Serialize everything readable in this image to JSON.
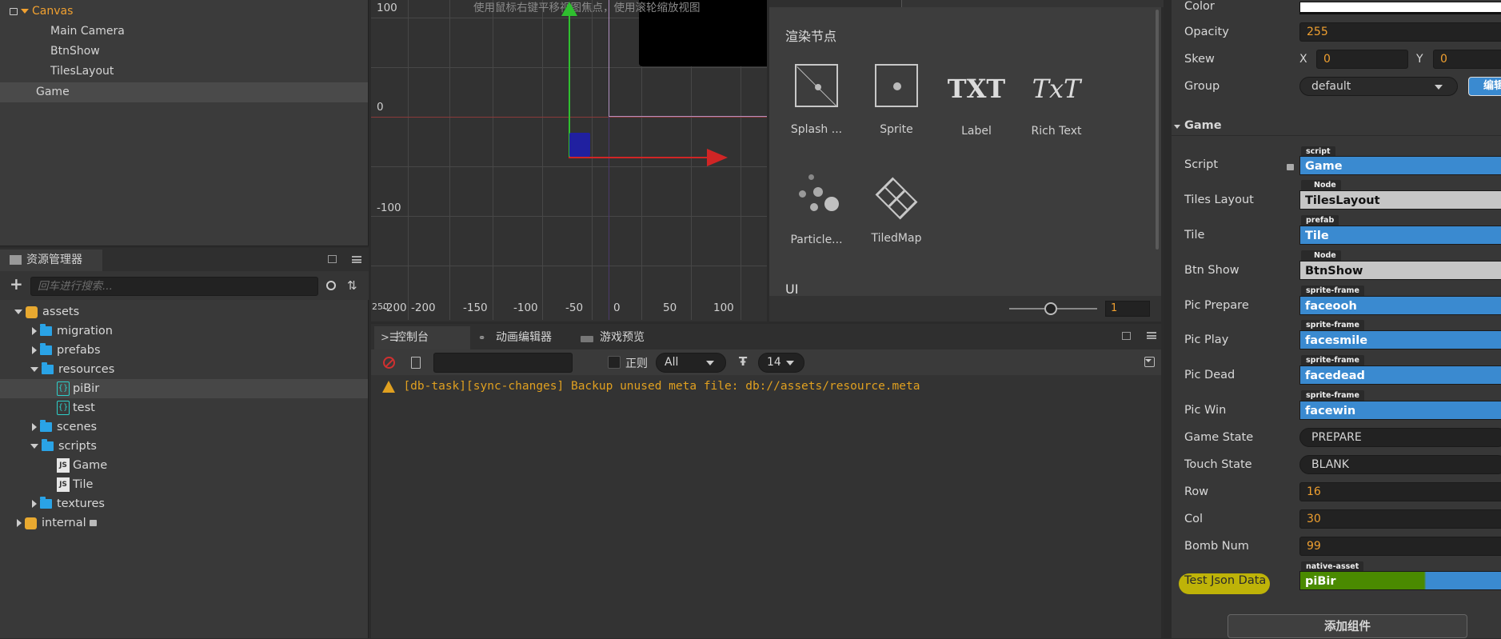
{
  "hierarchy": {
    "items": [
      {
        "label": "Canvas"
      },
      {
        "label": "Main Camera"
      },
      {
        "label": "BtnShow"
      },
      {
        "label": "TilesLayout"
      },
      {
        "label": "Game"
      }
    ]
  },
  "assets": {
    "title": "资源管理器",
    "search_placeholder": "回车进行搜索...",
    "items": [
      {
        "label": "assets"
      },
      {
        "label": "migration"
      },
      {
        "label": "prefabs"
      },
      {
        "label": "resources"
      },
      {
        "label": "piBir"
      },
      {
        "label": "test"
      },
      {
        "label": "scenes"
      },
      {
        "label": "scripts"
      },
      {
        "label": "Game"
      },
      {
        "label": "Tile"
      },
      {
        "label": "textures"
      },
      {
        "label": "internal"
      }
    ],
    "json_icon": "{}",
    "js_icon": "JS"
  },
  "scene": {
    "hint": "使用鼠标右键平移视图焦点，使用滚轮缩放视图",
    "y_ticks": [
      "100",
      "0",
      "-100",
      "-200"
    ],
    "x_ticks": [
      "250",
      "-200",
      "-150",
      "-100",
      "-50",
      "0",
      "50",
      "100"
    ],
    "zoom_value": "1"
  },
  "components": {
    "section_render": "渲染节点",
    "items": [
      {
        "label": "Splash ...",
        "icon": "splash-icon"
      },
      {
        "label": "Sprite",
        "icon": "sprite-icon"
      },
      {
        "label": "Label",
        "icon": "label-icon",
        "glyph": "TXT"
      },
      {
        "label": "Rich Text",
        "icon": "rich-text-icon",
        "glyph": "TxT"
      },
      {
        "label": "Particle...",
        "icon": "particle-icon"
      },
      {
        "label": "TiledMap",
        "icon": "tiledmap-icon"
      }
    ],
    "section_ui": "UI"
  },
  "console": {
    "tabs": [
      {
        "label": "控制台",
        "icon": "console-icon"
      },
      {
        "label": "动画编辑器",
        "icon": "animation-icon"
      },
      {
        "label": "游戏预览",
        "icon": "preview-icon"
      }
    ],
    "regex_label": "正则",
    "level_select": "All",
    "font_size": "14",
    "warning": "[db-task][sync-changes] Backup unused meta file: db://assets/resource.meta"
  },
  "inspector": {
    "color_label": "Color",
    "opacity_label": "Opacity",
    "opacity_value": "255",
    "skew_label": "Skew",
    "skew_x_label": "X",
    "skew_x": "0",
    "skew_y_label": "Y",
    "skew_y": "0",
    "group_label": "Group",
    "group_value": "default",
    "group_edit": "编辑",
    "section": "Game",
    "script_label": "Script",
    "script_tag": "script",
    "script_value": "Game",
    "tiles_layout_label": "Tiles Layout",
    "tiles_layout_tag": "Node",
    "tiles_layout_value": "TilesLayout",
    "tile_label": "Tile",
    "tile_tag": "prefab",
    "tile_value": "Tile",
    "btn_show_label": "Btn Show",
    "btn_show_tag": "Node",
    "btn_show_value": "BtnShow",
    "pic_prepare_label": "Pic Prepare",
    "pic_prepare_tag": "sprite-frame",
    "pic_prepare_value": "faceooh",
    "pic_play_label": "Pic Play",
    "pic_play_tag": "sprite-frame",
    "pic_play_value": "facesmile",
    "pic_dead_label": "Pic Dead",
    "pic_dead_tag": "sprite-frame",
    "pic_dead_value": "facedead",
    "pic_win_label": "Pic Win",
    "pic_win_tag": "sprite-frame",
    "pic_win_value": "facewin",
    "game_state_label": "Game State",
    "game_state_value": "PREPARE",
    "touch_state_label": "Touch State",
    "touch_state_value": "BLANK",
    "row_label": "Row",
    "row_value": "16",
    "col_label": "Col",
    "col_value": "30",
    "bomb_label": "Bomb Num",
    "bomb_value": "99",
    "json_label": "Test Json Data",
    "json_tag": "native-asset",
    "json_value": "piBir",
    "add_component": "添加组件"
  },
  "colors": {
    "accent_orange": "#f0a030",
    "ref_blue": "#3a8ad0",
    "highlight_yellow": "#d6c900",
    "highlight_green": "#4a8a00"
  }
}
